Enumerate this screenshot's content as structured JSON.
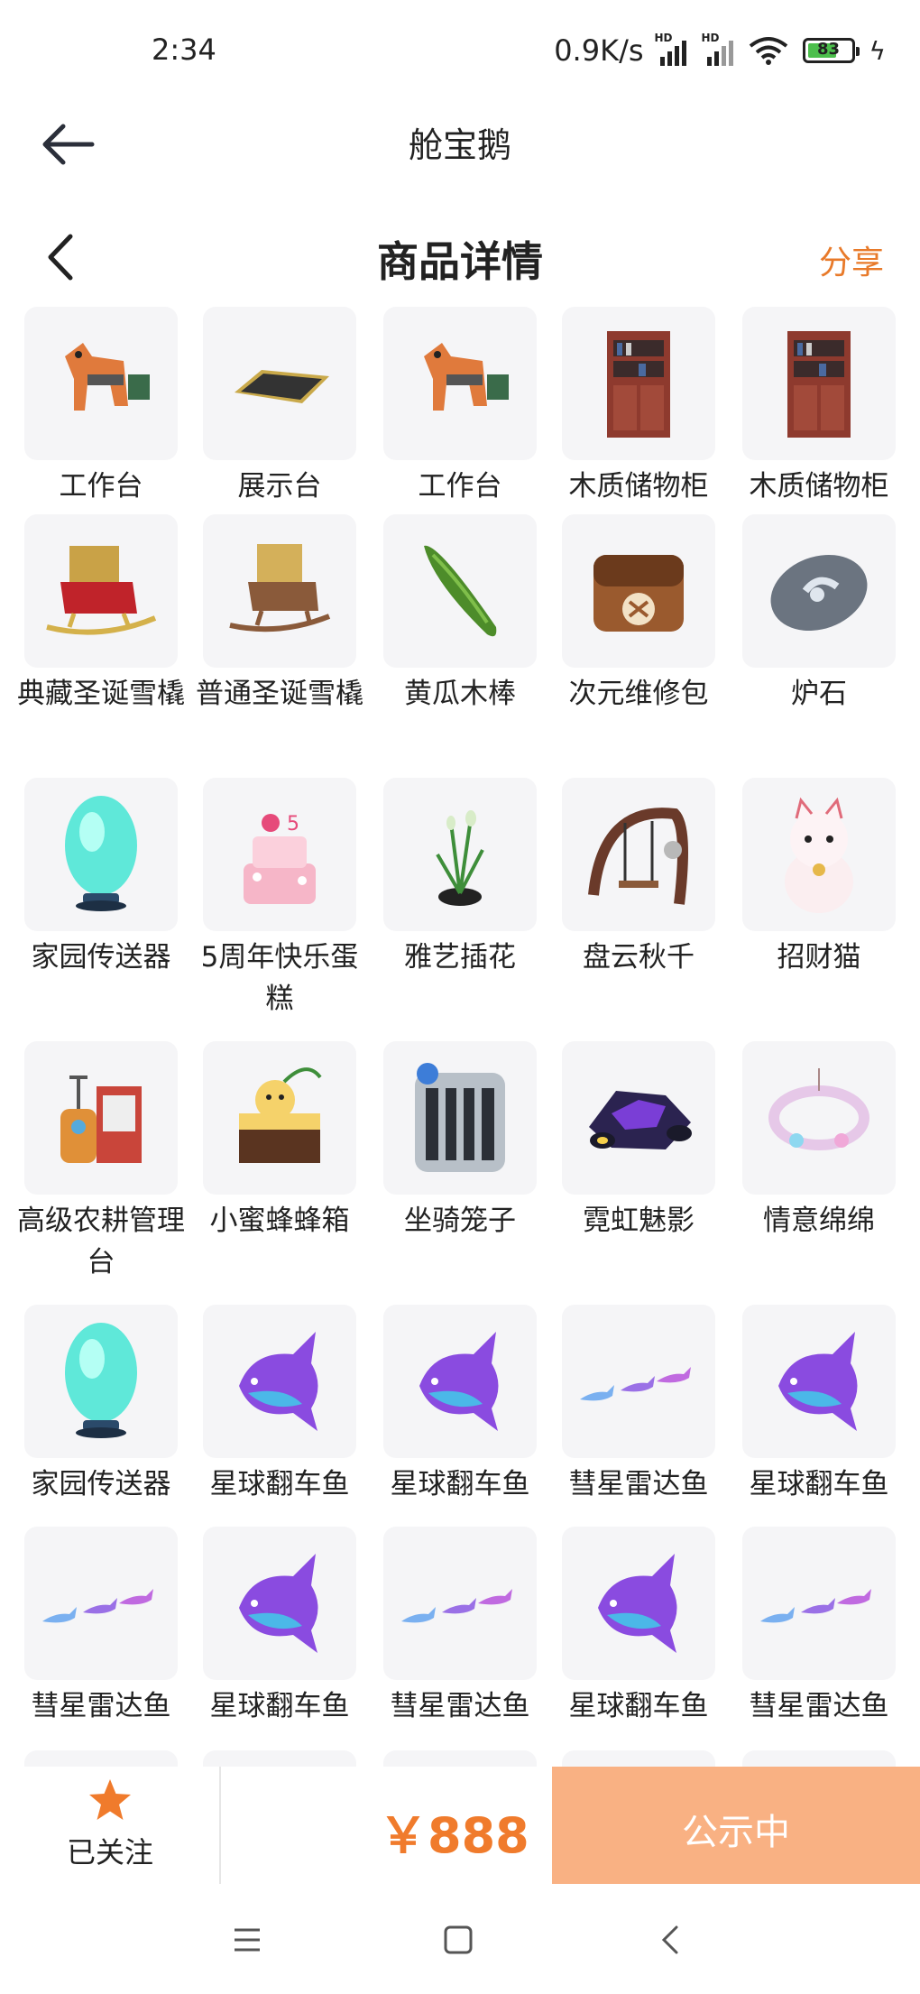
{
  "status_bar": {
    "time": "2:34",
    "network_speed": "0.9K/s",
    "signal_label": "HD",
    "battery_level": "83"
  },
  "app_header": {
    "title": "舱宝鹅"
  },
  "product_header": {
    "title": "商品详情",
    "share_label": "分享"
  },
  "items": [
    {
      "label": "工作台",
      "icon": "horse-workbench-icon"
    },
    {
      "label": "展示台",
      "icon": "display-stand-icon"
    },
    {
      "label": "工作台",
      "icon": "horse-workbench-icon"
    },
    {
      "label": "木质储物柜",
      "icon": "wooden-cabinet-icon"
    },
    {
      "label": "木质储物柜",
      "icon": "wooden-cabinet-icon"
    },
    {
      "label": "典藏圣诞雪橇",
      "icon": "red-sleigh-icon"
    },
    {
      "label": "普通圣诞雪橇",
      "icon": "brown-sleigh-icon"
    },
    {
      "label": "黄瓜木棒",
      "icon": "cucumber-icon"
    },
    {
      "label": "次元维修包",
      "icon": "repair-bag-icon"
    },
    {
      "label": "炉石",
      "icon": "hearthstone-icon"
    },
    {
      "label": "家园传送器",
      "icon": "teleporter-egg-icon"
    },
    {
      "label": "5周年快乐蛋糕",
      "icon": "cake-icon"
    },
    {
      "label": "雅艺插花",
      "icon": "flower-pot-icon"
    },
    {
      "label": "盘云秋千",
      "icon": "swing-icon"
    },
    {
      "label": "招财猫",
      "icon": "lucky-cat-icon"
    },
    {
      "label": "高级农耕管理台",
      "icon": "farm-console-icon"
    },
    {
      "label": "小蜜蜂蜂箱",
      "icon": "beehive-icon"
    },
    {
      "label": "坐骑笼子",
      "icon": "cage-icon"
    },
    {
      "label": "霓虹魅影",
      "icon": "neon-vehicle-icon"
    },
    {
      "label": "情意绵绵",
      "icon": "ornament-wreath-icon"
    },
    {
      "label": "家园传送器",
      "icon": "teleporter-egg-icon"
    },
    {
      "label": "星球翻车鱼",
      "icon": "sunfish-icon"
    },
    {
      "label": "星球翻车鱼",
      "icon": "sunfish-icon"
    },
    {
      "label": "彗星雷达鱼",
      "icon": "comet-fish-icon"
    },
    {
      "label": "星球翻车鱼",
      "icon": "sunfish-icon"
    },
    {
      "label": "彗星雷达鱼",
      "icon": "comet-fish-icon"
    },
    {
      "label": "星球翻车鱼",
      "icon": "sunfish-icon"
    },
    {
      "label": "彗星雷达鱼",
      "icon": "comet-fish-icon"
    },
    {
      "label": "星球翻车鱼",
      "icon": "sunfish-icon"
    },
    {
      "label": "彗星雷达鱼",
      "icon": "comet-fish-icon"
    }
  ],
  "action_bar": {
    "follow_label": "已关注",
    "price": "￥888",
    "status_button": "公示中"
  },
  "colors": {
    "accent": "#f07b2c",
    "button_bg": "#f9b183",
    "thumb_bg": "#f5f5f7"
  }
}
